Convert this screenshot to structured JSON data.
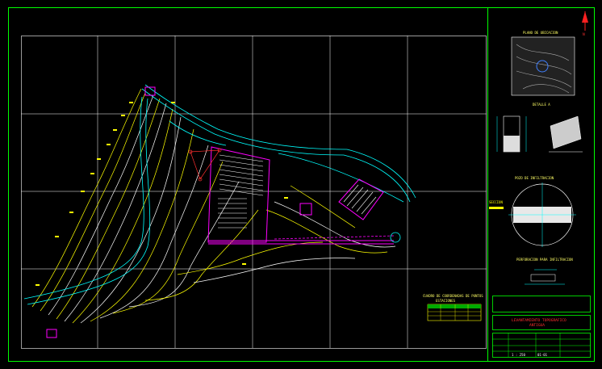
{
  "sheet": {
    "title_block": {
      "project_title": "LEVANTAMIENTO TOPOGRAFICO",
      "project_subtitle": "ANTIGUA",
      "scale": "1 : 250",
      "sheet_code": "01-01"
    },
    "details": {
      "location_plan": "PLANO DE UBICACION",
      "detail_a": "DETALLE A",
      "well_detail": "POZO DE INFILTRACION",
      "section": "SECCION",
      "infiltration_detail": "PERFORACION PARA INFILTRACION"
    },
    "legend_table": {
      "title": "CUADRO DE COORDENADAS DE PUNTOS",
      "subtitle": "ESTACIONES"
    }
  },
  "colors": {
    "border": "#00ff00",
    "grid": "#ffffff",
    "contour_major": "#ffff00",
    "contour_minor": "#ffffff",
    "road": "#00ffff",
    "property": "#ff00ff",
    "title_text": "#ff2020"
  }
}
